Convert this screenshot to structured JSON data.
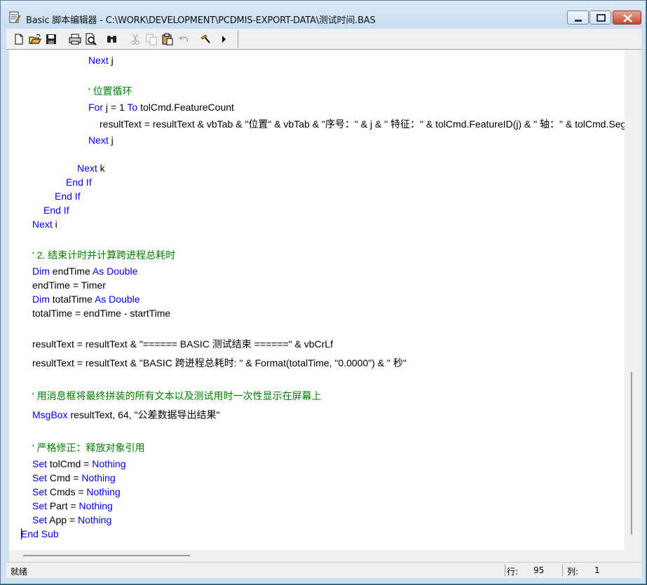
{
  "window": {
    "title": "Basic 脚本编辑器 - C:\\WORK\\DEVELOPMENT\\PCDMIS-EXPORT-DATA\\测试时间.BAS"
  },
  "toolbar": {
    "icons": [
      "new-file-icon",
      "open-folder-icon",
      "save-icon",
      "print-icon",
      "print-preview-icon",
      "find-icon",
      "cut-icon",
      "copy-icon",
      "paste-icon",
      "undo-icon",
      "compile-icon",
      "run-icon"
    ]
  },
  "code": {
    "l1": {
      "kw": "Next",
      "rest": " j"
    },
    "l2": {
      "cm": "' 位置循环"
    },
    "l3": {
      "kw1": "For",
      "mid": " j = 1 ",
      "kw2": "To",
      "rest": " tolCmd.FeatureCount"
    },
    "l4": {
      "text": "resultText = resultText & vbTab & \"位置\" & vbTab & \"序号：\" & j & \" 特征：\" & tolCmd.FeatureID(j) & \" 轴：\" & tolCmd.Seg"
    },
    "l5": {
      "kw": "Next",
      "rest": " j"
    },
    "l6": {
      "kw": "Next",
      "rest": " k"
    },
    "l7": {
      "kw": "End If"
    },
    "l8": {
      "kw": "End If"
    },
    "l9": {
      "kw": "End If"
    },
    "l10": {
      "kw": "Next",
      "rest": " i"
    },
    "l11": {
      "cm": "' 2. 结束计时并计算跨进程总耗时"
    },
    "l12": {
      "kw1": "Dim",
      "mid": " endTime ",
      "kw2": "As Double"
    },
    "l13": {
      "text": "endTime = Timer"
    },
    "l14": {
      "kw1": "Dim",
      "mid": " totalTime ",
      "kw2": "As Double"
    },
    "l15": {
      "text": "totalTime = endTime - startTime"
    },
    "l16": {
      "text": "resultText = resultText & \"====== BASIC 测试结束 ======\" & vbCrLf"
    },
    "l17": {
      "text": "resultText = resultText & \"BASIC 跨进程总耗时: \" & Format(totalTime, \"0.0000\") & \" 秒\""
    },
    "l18": {
      "cm": "' 用消息框将最终拼装的所有文本以及测试用时一次性显示在屏幕上"
    },
    "l19": {
      "kw": "MsgBox",
      "rest": " resultText, 64, \"公差数据导出结果\""
    },
    "l20": {
      "cm": "' 严格修正：释放对象引用"
    },
    "l21": {
      "kw1": "Set",
      "mid": " tolCmd = ",
      "kw2": "Nothing"
    },
    "l22": {
      "kw1": "Set",
      "mid": " Cmd = ",
      "kw2": "Nothing"
    },
    "l23": {
      "kw1": "Set",
      "mid": " Cmds = ",
      "kw2": "Nothing"
    },
    "l24": {
      "kw1": "Set",
      "mid": " Part = ",
      "kw2": "Nothing"
    },
    "l25": {
      "kw1": "Set",
      "mid": " App = ",
      "kw2": "Nothing"
    },
    "l26": {
      "kw": "End Sub"
    }
  },
  "status": {
    "state": "就绪",
    "row_label": "行:",
    "row_value": "95",
    "col_label": "列:",
    "col_value": "1"
  }
}
